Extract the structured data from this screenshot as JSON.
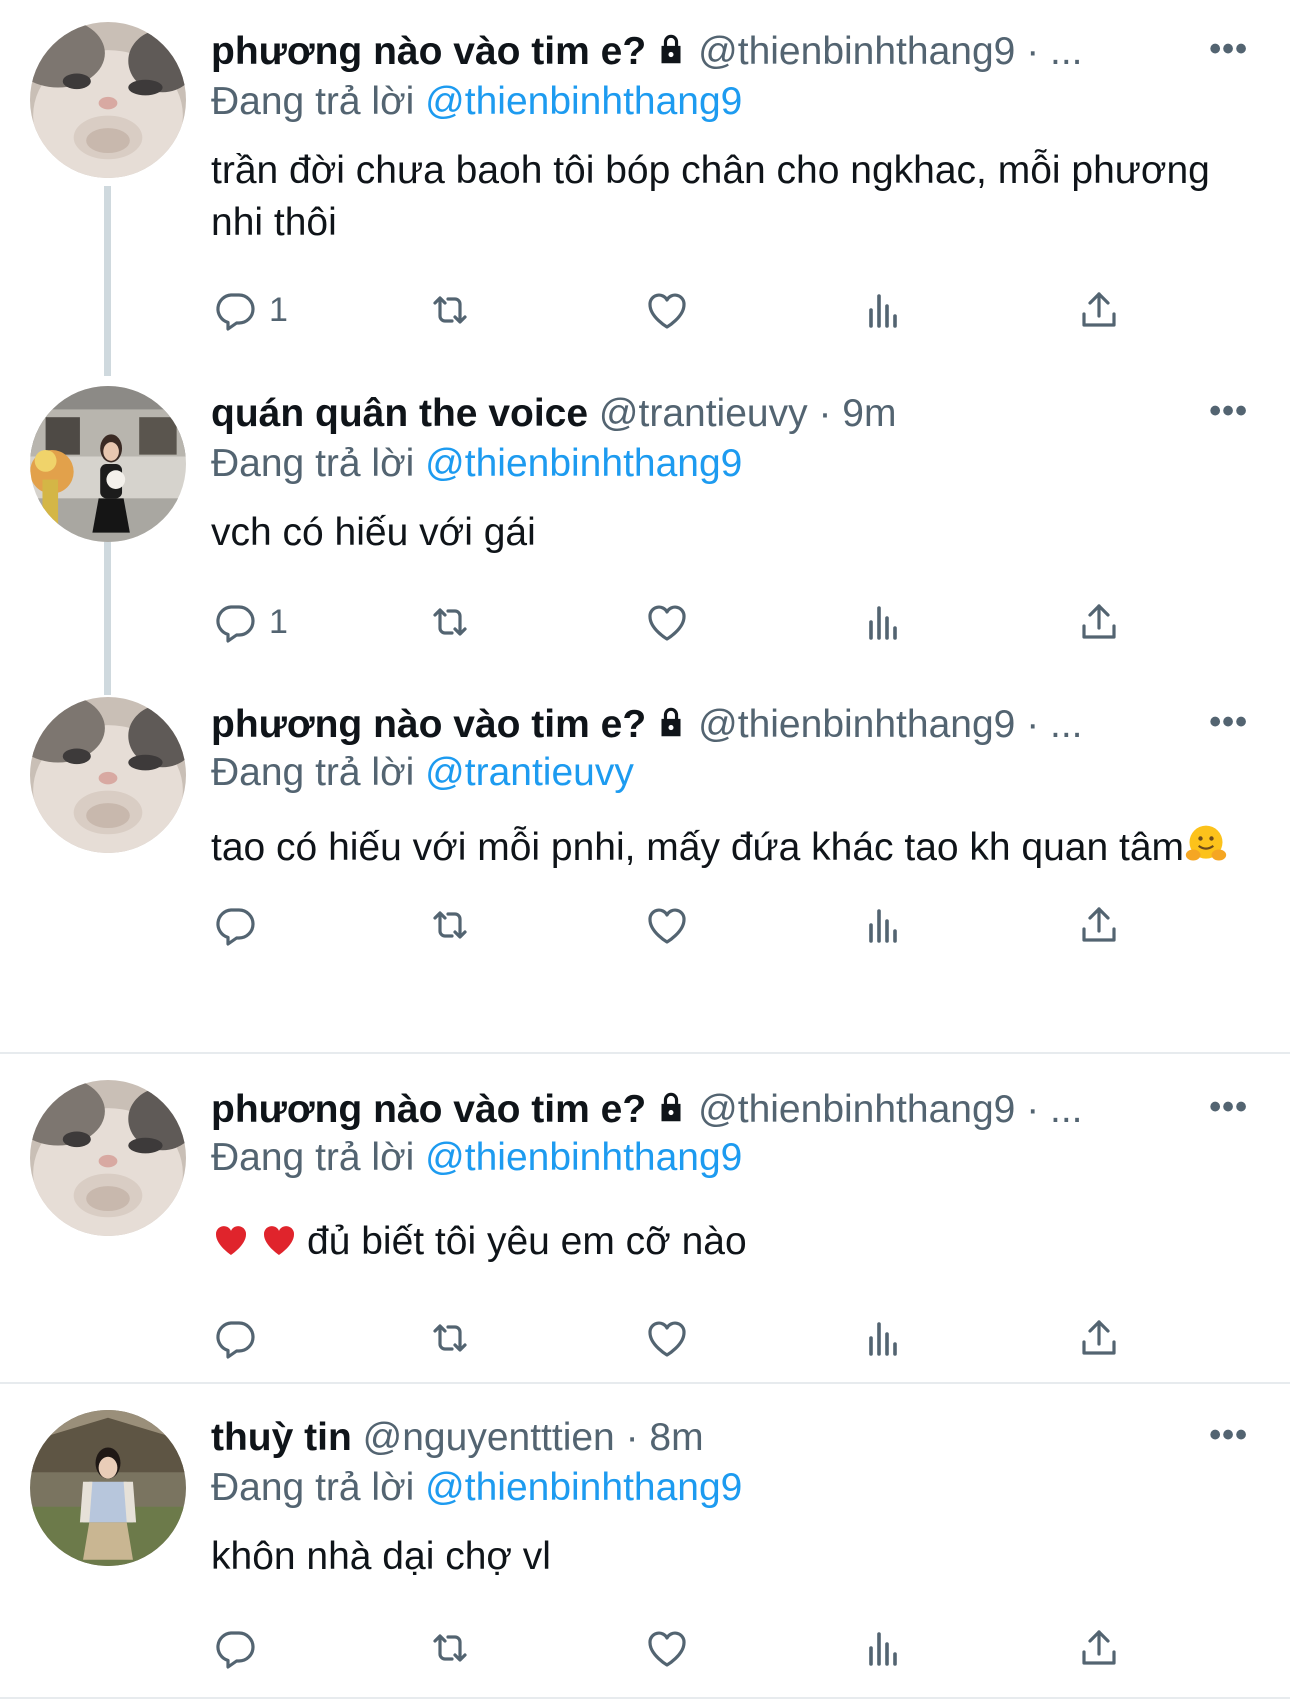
{
  "tweets": [
    {
      "name": "phương nào vào tim e?",
      "handle": "@thienbinhthang9",
      "time": "· ...",
      "reply_prefix": "Đang trả lời",
      "reply_to": "@thienbinhthang9",
      "text": "trần đời chưa baoh tôi bóp chân cho ngkhac, mỗi phương nhi thôi",
      "reply_count": "1",
      "more": "•••"
    },
    {
      "name": "quán quân the voice",
      "handle": "@trantieuvy",
      "time": "· 9m",
      "reply_prefix": "Đang trả lời",
      "reply_to": "@thienbinhthang9",
      "text": "vch có hiếu với gái",
      "reply_count": "1",
      "more": "•••"
    },
    {
      "name": "phương nào vào tim e?",
      "handle": "@thienbinhthang9",
      "time": "· ...",
      "reply_prefix": "Đang trả lời",
      "reply_to": "@trantieuvy",
      "text": "tao có hiếu với mỗi pnhi, mấy đứa khác tao kh quan tâm",
      "reply_count": "",
      "more": "•••"
    },
    {
      "name": "phương nào vào tim e?",
      "handle": "@thienbinhthang9",
      "time": "· ...",
      "reply_prefix": "Đang trả lời",
      "reply_to": "@thienbinhthang9",
      "text": "đủ biết tôi yêu em cỡ nào",
      "reply_count": "",
      "more": "•••"
    },
    {
      "name": "thuỳ tin",
      "handle": "@nguyentttien",
      "time": "· 8m",
      "reply_prefix": "Đang trả lời",
      "reply_to": "@thienbinhthang9",
      "text": "khôn nhà dại chợ vl",
      "reply_count": "",
      "more": "•••"
    }
  ],
  "colors": {
    "link": "#1d9bf0",
    "secondary": "#536471",
    "thread": "#cfd9de"
  },
  "icons": [
    "lock-icon",
    "reply-icon",
    "retweet-icon",
    "like-icon",
    "views-icon",
    "share-icon",
    "more-icon"
  ]
}
